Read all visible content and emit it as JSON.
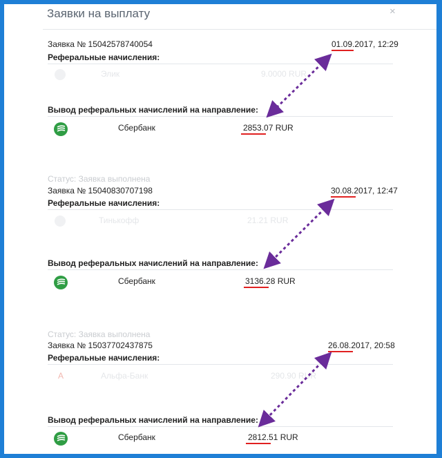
{
  "modal": {
    "title": "Заявки на выплату",
    "close_glyph": "×"
  },
  "labels": {
    "referral": "Реферальные начисления:",
    "withdrawal": "Вывод реферальных начислений на направление:"
  },
  "requests": [
    {
      "status": "",
      "number": "Заявка № 15042578740054",
      "date": "01.09.2017, 12:29",
      "faded_source": {
        "name": "Элик",
        "amount": "9.0000 RUR"
      },
      "bank": "Сбербанк",
      "amount": "2853.07 RUR"
    },
    {
      "status": "Статус: Заявка выполнена",
      "number": "Заявка № 15040830707198",
      "date": "30.08.2017, 12:47",
      "faded_source": {
        "name": "Тинькофф",
        "amount": "21.21 RUR"
      },
      "bank": "Сбербанк",
      "amount": "3136.28 RUR"
    },
    {
      "status": "Статус: Заявка выполнена",
      "number": "Заявка № 15037702437875",
      "date": "26.08.2017, 20:58",
      "faded_source": {
        "name": "Альфа-Банк",
        "amount": "290.90 RUR"
      },
      "bank": "Сбербанк",
      "amount": "2812.51 RUR"
    }
  ],
  "colors": {
    "frame": "#1e7fd6",
    "arrow": "#6a2c9a",
    "underline": "#e02020",
    "bank_green": "#2f9d44"
  }
}
